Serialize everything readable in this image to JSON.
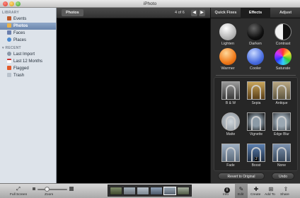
{
  "window": {
    "title": "iPhoto"
  },
  "sidebar": {
    "library_heading": "LIBRARY",
    "library_items": [
      {
        "label": "Events",
        "icon": "events-icon"
      },
      {
        "label": "Photos",
        "icon": "photos-icon",
        "selected": true
      },
      {
        "label": "Faces",
        "icon": "faces-icon"
      },
      {
        "label": "Places",
        "icon": "places-icon"
      }
    ],
    "recent_heading": "RECENT",
    "recent_items": [
      {
        "label": "Last Import",
        "icon": "last-import-icon"
      },
      {
        "label": "Last 12 Months",
        "icon": "calendar-icon"
      },
      {
        "label": "Flagged",
        "icon": "flag-icon"
      },
      {
        "label": "Trash",
        "icon": "trash-icon"
      }
    ]
  },
  "toolbar": {
    "photos_label": "Photos",
    "count": "4 of 6",
    "prev_icon": "arrow-left-icon",
    "next_icon": "arrow-right-icon"
  },
  "edit_panel": {
    "tabs": [
      "Quick Fixes",
      "Effects",
      "Adjust"
    ],
    "active_tab": "Effects",
    "quick_effects": [
      "Lighten",
      "Darken",
      "Contrast",
      "Warmer",
      "Cooler",
      "Saturate"
    ],
    "effects": [
      "B & W",
      "Sepia",
      "Antique",
      "Matte",
      "Vignette",
      "Edge Blur",
      "Fade",
      "Boost",
      "None"
    ],
    "boost_badge": "2",
    "revert_label": "Revert to Original",
    "undo_label": "Undo"
  },
  "bottom": {
    "full_screen": "Full Screen",
    "zoom": "Zoom",
    "zoom_level": 0.3,
    "buttons": [
      "Info",
      "Edit",
      "Create",
      "Add To",
      "Share"
    ]
  },
  "colors": {
    "accent": "#6b86ad"
  }
}
